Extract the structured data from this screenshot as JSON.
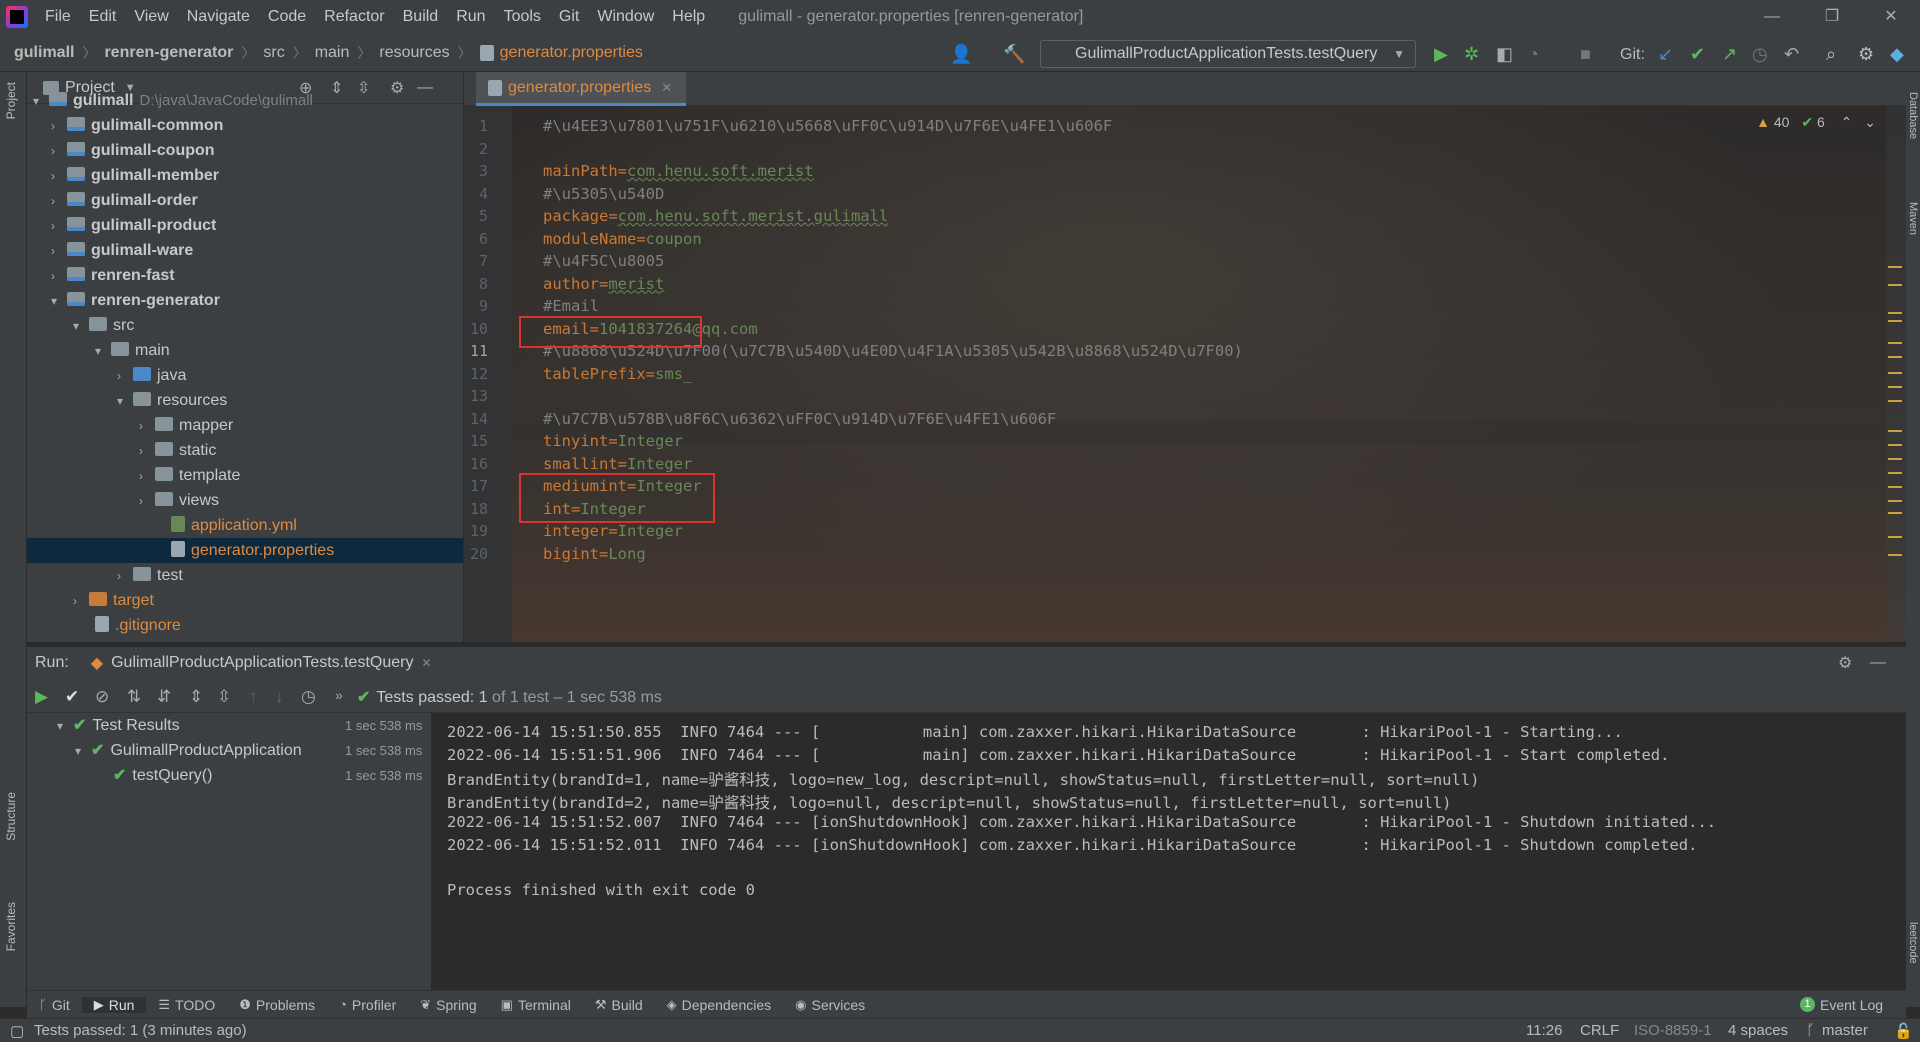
{
  "menubar": {
    "items": [
      "File",
      "Edit",
      "View",
      "Navigate",
      "Code",
      "Refactor",
      "Build",
      "Run",
      "Tools",
      "Git",
      "Window",
      "Help"
    ],
    "title": "gulimall - generator.properties [renren-generator]"
  },
  "navbar": {
    "crumbs": [
      "gulimall",
      "renren-generator",
      "src",
      "main",
      "resources"
    ],
    "current_file": "generator.properties",
    "run_config": "GulimallProductApplicationTests.testQuery",
    "git_label": "Git:"
  },
  "project": {
    "title": "Project",
    "tree": [
      {
        "label": "gulimall",
        "path": "D:\\java\\JavaCode\\gulimall"
      },
      {
        "label": "gulimall-common"
      },
      {
        "label": "gulimall-coupon"
      },
      {
        "label": "gulimall-member"
      },
      {
        "label": "gulimall-order"
      },
      {
        "label": "gulimall-product"
      },
      {
        "label": "gulimall-ware"
      },
      {
        "label": "renren-fast"
      },
      {
        "label": "renren-generator"
      },
      {
        "label": "src"
      },
      {
        "label": "main"
      },
      {
        "label": "java"
      },
      {
        "label": "resources"
      },
      {
        "label": "mapper"
      },
      {
        "label": "static"
      },
      {
        "label": "template"
      },
      {
        "label": "views"
      },
      {
        "label": "application.yml"
      },
      {
        "label": "generator.properties"
      },
      {
        "label": "test"
      },
      {
        "label": "target"
      },
      {
        "label": ".gitignore"
      }
    ]
  },
  "editor": {
    "tab": "generator.properties",
    "inspections": {
      "warnings": "40",
      "ok": "6"
    },
    "lines": [
      {
        "n": "1",
        "text": "#\\u4EE3\\u7801\\u751F\\u6210\\u5668\\uFF0C\\u914D\\u7F6E\\u4FE1\\u606F"
      },
      {
        "n": "2",
        "text": ""
      },
      {
        "n": "3",
        "key": "mainPath",
        "val": "com.henu.soft.merist"
      },
      {
        "n": "4",
        "text": "#\\u5305\\u540D"
      },
      {
        "n": "5",
        "key": "package",
        "val": "com.henu.soft.merist.gulimall"
      },
      {
        "n": "6",
        "key": "moduleName",
        "val": "coupon"
      },
      {
        "n": "7",
        "text": "#\\u4F5C\\u8005"
      },
      {
        "n": "8",
        "key": "author",
        "val": "merist"
      },
      {
        "n": "9",
        "text": "#Email"
      },
      {
        "n": "10",
        "key": "email",
        "val": "1041837264@qq.com"
      },
      {
        "n": "11",
        "text": "#\\u8868\\u524D\\u7F00(\\u7C7B\\u540D\\u4E0D\\u4F1A\\u5305\\u542B\\u8868\\u524D\\u7F00)"
      },
      {
        "n": "12",
        "key": "tablePrefix",
        "val": "sms_"
      },
      {
        "n": "13",
        "text": ""
      },
      {
        "n": "14",
        "text": "#\\u7C7B\\u578B\\u8F6C\\u6362\\uFF0C\\u914D\\u7F6E\\u4FE1\\u606F"
      },
      {
        "n": "15",
        "key": "tinyint",
        "val": "Integer"
      },
      {
        "n": "16",
        "key": "smallint",
        "val": "Integer"
      },
      {
        "n": "17",
        "key": "mediumint",
        "val": "Integer"
      },
      {
        "n": "18",
        "key": "int",
        "val": "Integer"
      },
      {
        "n": "19",
        "key": "integer",
        "val": "Integer"
      },
      {
        "n": "20",
        "key": "bigint",
        "val": "Long"
      }
    ]
  },
  "run": {
    "label": "Run:",
    "config": "GulimallProductApplicationTests.testQuery",
    "status": "Tests passed:",
    "status_count": "1",
    "status_rest": "of 1 test – 1 sec 538 ms",
    "tests": [
      {
        "label": "Test Results",
        "time": "1 sec 538 ms"
      },
      {
        "label": "GulimallProductApplication",
        "time": "1 sec 538 ms"
      },
      {
        "label": "testQuery()",
        "time": "1 sec 538 ms"
      }
    ],
    "console": [
      "2022-06-14 15:51:50.855  INFO 7464 --- [           main] com.zaxxer.hikari.HikariDataSource       : HikariPool-1 - Starting...",
      "2022-06-14 15:51:51.906  INFO 7464 --- [           main] com.zaxxer.hikari.HikariDataSource       : HikariPool-1 - Start completed.",
      "BrandEntity(brandId=1, name=驴酱科技, logo=new_log, descript=null, showStatus=null, firstLetter=null, sort=null)",
      "BrandEntity(brandId=2, name=驴酱科技, logo=null, descript=null, showStatus=null, firstLetter=null, sort=null)",
      "2022-06-14 15:51:52.007  INFO 7464 --- [ionShutdownHook] com.zaxxer.hikari.HikariDataSource       : HikariPool-1 - Shutdown initiated...",
      "2022-06-14 15:51:52.011  INFO 7464 --- [ionShutdownHook] com.zaxxer.hikari.HikariDataSource       : HikariPool-1 - Shutdown completed.",
      "",
      "Process finished with exit code 0"
    ]
  },
  "toolwindows": [
    "Git",
    "Run",
    "TODO",
    "Problems",
    "Profiler",
    "Spring",
    "Terminal",
    "Build",
    "Dependencies",
    "Services"
  ],
  "event_log": "Event Log",
  "event_count": "1",
  "side": {
    "project": "Project",
    "structure": "Structure",
    "favorites": "Favorites",
    "database": "Database",
    "maven": "Maven",
    "leetcode": "leetcode"
  },
  "status": {
    "message": "Tests passed: 1 (3 minutes ago)",
    "position": "11:26",
    "line_sep": "CRLF",
    "encoding": "ISO-8859-1",
    "indent": "4 spaces",
    "branch": "master"
  }
}
